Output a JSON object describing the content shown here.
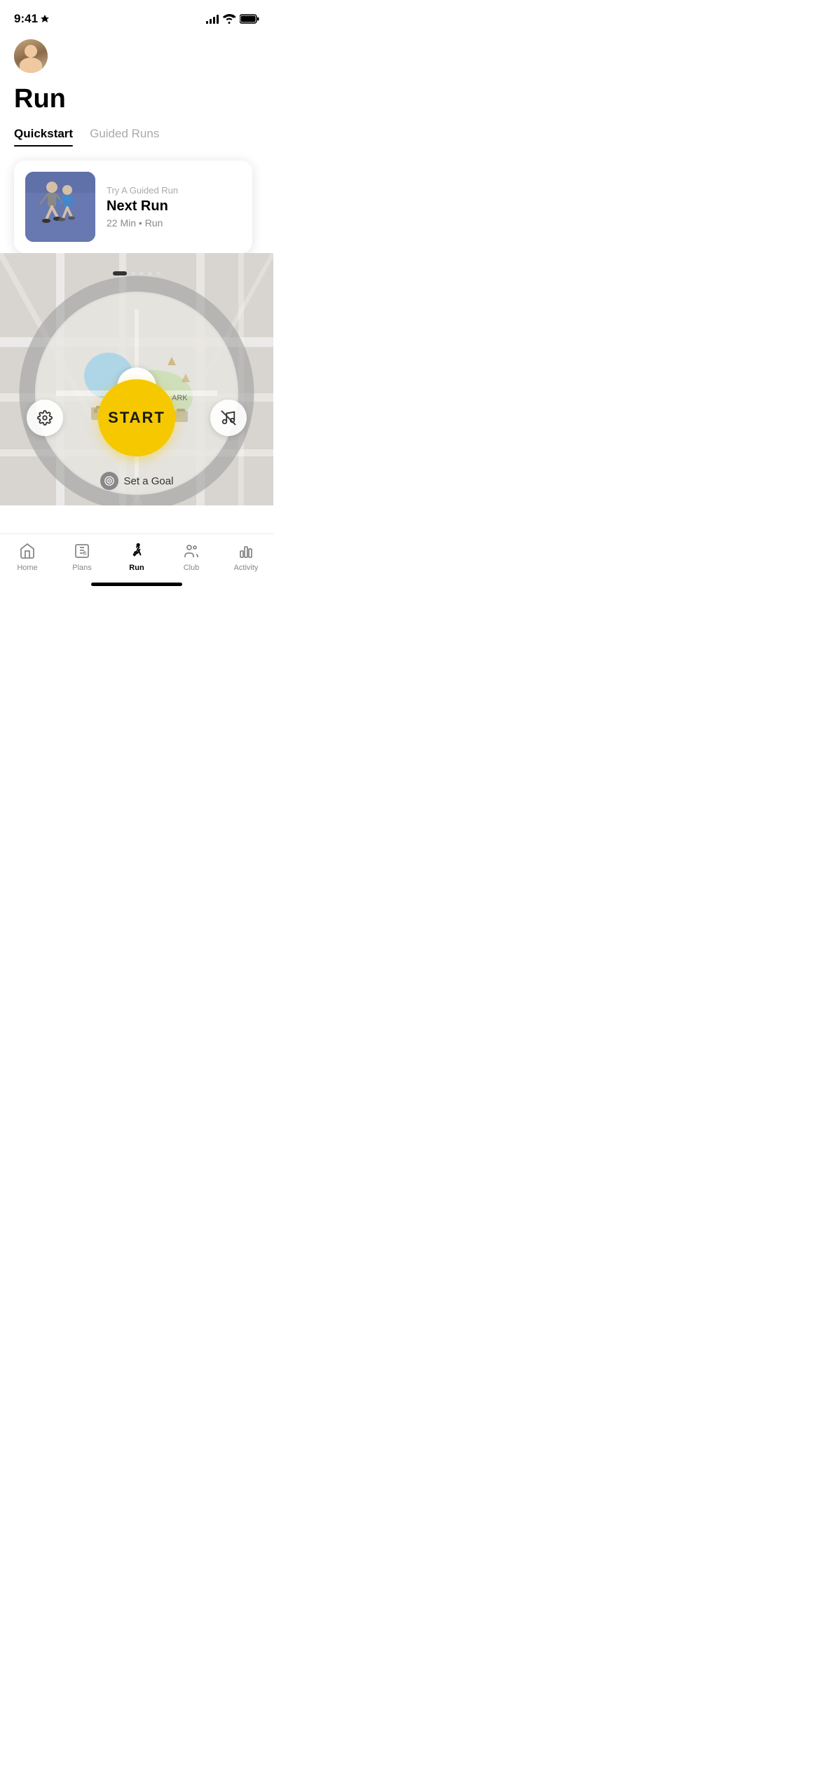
{
  "statusBar": {
    "time": "9:41",
    "locationIcon": "▶"
  },
  "header": {
    "pageTitle": "Run"
  },
  "tabs": [
    {
      "id": "quickstart",
      "label": "Quickstart",
      "active": true
    },
    {
      "id": "guided",
      "label": "Guided Runs",
      "active": false
    }
  ],
  "card": {
    "label": "Try A Guided Run",
    "title": "Next Run",
    "meta": "22 Min • Run"
  },
  "carouselDots": [
    {
      "active": true
    },
    {
      "active": false
    },
    {
      "active": false
    },
    {
      "active": false
    },
    {
      "active": false
    }
  ],
  "startButton": {
    "label": "START"
  },
  "setGoal": {
    "label": "Set a Goal"
  },
  "actionButtons": {
    "settings": "⚙",
    "music": "🎵"
  },
  "bottomNav": [
    {
      "id": "home",
      "label": "Home",
      "active": false,
      "icon": "home"
    },
    {
      "id": "plans",
      "label": "Plans",
      "active": false,
      "icon": "plans"
    },
    {
      "id": "run",
      "label": "Run",
      "active": true,
      "icon": "run"
    },
    {
      "id": "club",
      "label": "Club",
      "active": false,
      "icon": "club"
    },
    {
      "id": "activity",
      "label": "Activity",
      "active": false,
      "icon": "activity"
    }
  ],
  "colors": {
    "accent": "#f5c800",
    "active": "#000000",
    "inactive": "#888888"
  }
}
